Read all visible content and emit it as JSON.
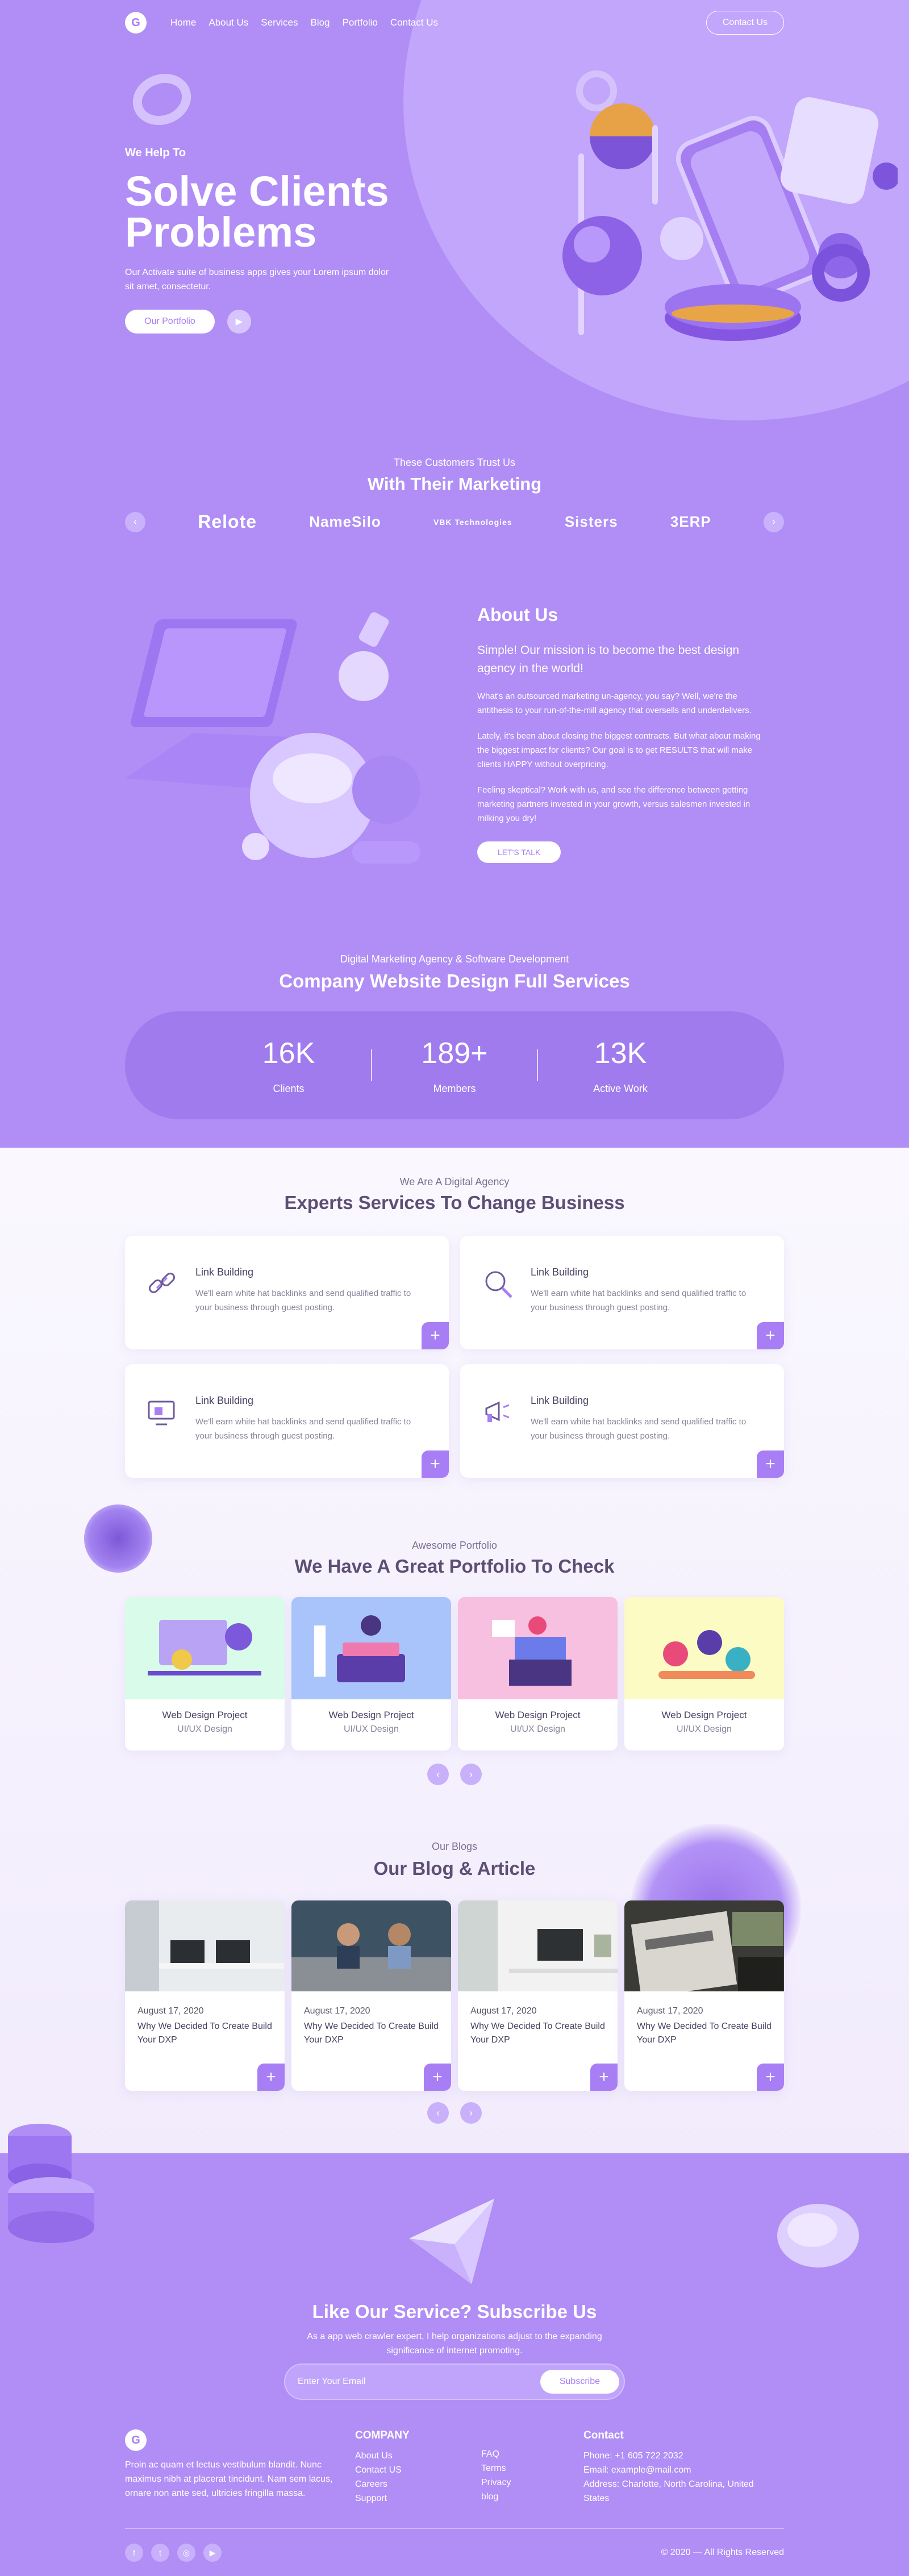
{
  "nav": {
    "logo": "G",
    "links": [
      "Home",
      "About Us",
      "Services",
      "Blog",
      "Portfolio",
      "Contact Us"
    ],
    "contact_button": "Contact Us"
  },
  "hero": {
    "subtitle": "We Help To",
    "title": "Solve Clients Problems",
    "description": "Our Activate suite of business apps gives your Lorem ipsum dolor sit amet, consectetur.",
    "portfolio_button": "Our Portfolio",
    "play_icon": "play-icon"
  },
  "trust": {
    "subtitle": "These Customers Trust Us",
    "title": "With Their Marketing",
    "brands": [
      "Relote",
      "NameSilo",
      "VBK Technologies",
      "Sisters",
      "3ERP"
    ]
  },
  "about": {
    "title": "About Us",
    "lead": "Simple! Our mission is to become the best design agency in the world!",
    "p1": "What's an outsourced marketing un-agency, you say? Well, we're the antithesis to your run-of-the-mill agency that oversells and underdelivers.",
    "p2": "Lately, it's been about closing the biggest contracts. But what about making the biggest impact for clients? Our goal is to get RESULTS that will make clients HAPPY without overpricing.",
    "p3": "Feeling skeptical? Work with us, and see the difference between getting marketing partners invested in your growth, versus salesmen invested in milking you dry!",
    "button": "LET'S TALK"
  },
  "stats": {
    "subtitle": "Digital Marketing Agency & Software Development",
    "title": "Company Website Design Full Services",
    "items": [
      {
        "value": "16K",
        "label": "Clients"
      },
      {
        "value": "189+",
        "label": "Members"
      },
      {
        "value": "13K",
        "label": "Active Work"
      }
    ]
  },
  "services": {
    "subtitle": "We Are A Digital Agency",
    "title": "Experts Services To Change Business",
    "items": [
      {
        "title": "Link Building",
        "desc": "We'll earn white hat backlinks and send qualified traffic to your business through guest posting.",
        "icon": "link-icon"
      },
      {
        "title": "Link Building",
        "desc": "We'll earn white hat backlinks and send qualified traffic to your business through guest posting.",
        "icon": "search-icon"
      },
      {
        "title": "Link Building",
        "desc": "We'll earn white hat backlinks and send qualified traffic to your business through guest posting.",
        "icon": "monitor-icon"
      },
      {
        "title": "Link Building",
        "desc": "We'll earn white hat backlinks and send qualified traffic to your business through guest posting.",
        "icon": "megaphone-icon"
      }
    ]
  },
  "portfolio": {
    "subtitle": "Awesome Portfolio",
    "title": "We Have A Great Portfolio To Check",
    "items": [
      {
        "title": "Web Design Project",
        "category": "UI/UX Design",
        "bg": "#d9fbe9"
      },
      {
        "title": "Web Design Project",
        "category": "UI/UX Design",
        "bg": "#a9c4fb"
      },
      {
        "title": "Web Design Project",
        "category": "UI/UX Design",
        "bg": "#f7bfe0"
      },
      {
        "title": "Web Design Project",
        "category": "UI/UX Design",
        "bg": "#fbfbc3"
      }
    ]
  },
  "blog": {
    "subtitle": "Our Blogs",
    "title": "Our Blog & Article",
    "items": [
      {
        "date": "August 17, 2020",
        "title": "Why We Decided To Create Build Your DXP"
      },
      {
        "date": "August 17, 2020",
        "title": "Why We Decided To Create Build Your DXP"
      },
      {
        "date": "August 17, 2020",
        "title": "Why We Decided To Create Build Your DXP"
      },
      {
        "date": "August 17, 2020",
        "title": "Why We Decided To Create Build Your DXP"
      }
    ]
  },
  "subscribe": {
    "title": "Like Our Service? Subscribe Us",
    "description": "As a app web crawler expert, I help organizations adjust to the expanding significance of internet promoting.",
    "placeholder": "Enter Your Email",
    "button": "Subscribe"
  },
  "footer": {
    "logo": "G",
    "description": "Proin ac quam et lectus vestibulum blandit. Nunc maximus nibh at placerat tincidunt. Nam sem lacus, ornare non ante sed, ultricies fringilla massa.",
    "company_title": "COMPANY",
    "company_links": [
      "About Us",
      "Contact US",
      "Careers",
      "Support"
    ],
    "more_links": [
      "FAQ",
      "Terms",
      "Privacy",
      "blog"
    ],
    "contact_title": "Contact",
    "phone": "Phone: +1 605 722 2032",
    "email": "Email: example@mail.com",
    "address": "Address: Charlotte, North Carolina, United States",
    "social": [
      "facebook-icon",
      "twitter-icon",
      "instagram-icon",
      "youtube-icon"
    ],
    "copyright": "© 2020 — All Rights Reserved"
  },
  "colors": {
    "primary": "#b08ef5",
    "accent": "#a87ef5",
    "card_title": "#4a3f62"
  }
}
